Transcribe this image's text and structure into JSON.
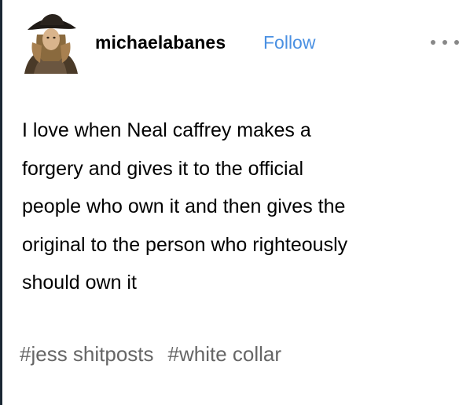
{
  "post": {
    "username": "michaelabanes",
    "follow_label": "Follow",
    "more_icon": "more-horizontal-icon",
    "text": "I love when Neal caffrey makes a\nforgery and gives it to the official\npeople who own it and then gives the\noriginal to the person who righteously\nshould own it",
    "tags": [
      "#jess shitposts",
      "#white collar"
    ]
  },
  "colors": {
    "follow": "#4a90e2",
    "tags": "#666666",
    "edge": "#1a2734"
  }
}
